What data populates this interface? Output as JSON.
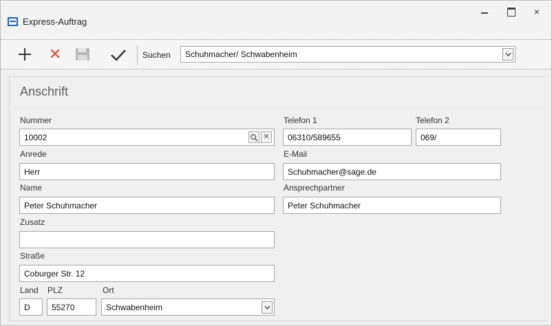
{
  "window": {
    "title": "Express-Auftrag",
    "icon": "app-window-icon"
  },
  "titlebar_buttons": {
    "minimize_icon": "minimize-icon",
    "maximize_icon": "maximize-icon",
    "close_label": "×"
  },
  "toolbar": {
    "add_icon": "plus-icon",
    "delete_label": "✕",
    "save_icon": "floppy-disk-icon",
    "confirm_icon": "checkmark-icon",
    "search_label": "Suchen",
    "search_value": "Schuhmacher/ Schwabenheim",
    "delete_color": "#e2492b"
  },
  "section": {
    "title": "Anschrift"
  },
  "form": {
    "nummer": {
      "label": "Nummer",
      "value": "10002"
    },
    "anrede": {
      "label": "Anrede",
      "value": "Herr"
    },
    "name": {
      "label": "Name",
      "value": "Peter Schuhmacher"
    },
    "zusatz": {
      "label": "Zusatz",
      "value": ""
    },
    "strasse": {
      "label": "Straße",
      "value": "Coburger Str. 12"
    },
    "land": {
      "label": "Land",
      "value": "D"
    },
    "plz": {
      "label": "PLZ",
      "value": "55270"
    },
    "ort": {
      "label": "Ort",
      "value": "Schwabenheim"
    },
    "telefon1": {
      "label": "Telefon 1",
      "value": "06310/589655"
    },
    "telefon2": {
      "label": "Telefon 2",
      "value": "069/"
    },
    "email": {
      "label": "E-Mail",
      "value": "Schuhmacher@sage.de"
    },
    "ansprechpartner": {
      "label": "Ansprechpartner",
      "value": "Peter Schuhmacher"
    }
  },
  "nummer_buttons": {
    "search_label": "🔍",
    "clear_label": "✕"
  }
}
